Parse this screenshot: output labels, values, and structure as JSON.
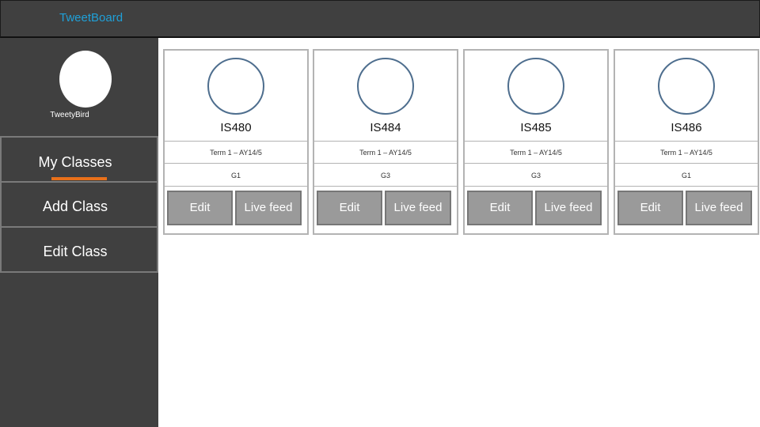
{
  "header": {
    "title": "TweetBoard",
    "title_color": "#1fa0d8"
  },
  "sidebar": {
    "username": "TweetyBird",
    "active_color": "#e8701a",
    "items": [
      {
        "label": "My Classes",
        "active": true
      },
      {
        "label": "Add Class",
        "active": false
      },
      {
        "label": "Edit Class",
        "active": false
      }
    ]
  },
  "classes": [
    {
      "code": "IS480",
      "term": "Term 1 – AY14/5",
      "group": "G1",
      "edit_label": "Edit",
      "live_label": "Live feed"
    },
    {
      "code": "IS484",
      "term": "Term 1 – AY14/5",
      "group": "G3",
      "edit_label": "Edit",
      "live_label": "Live feed"
    },
    {
      "code": "IS485",
      "term": "Term 1 – AY14/5",
      "group": "G3",
      "edit_label": "Edit",
      "live_label": "Live feed"
    },
    {
      "code": "IS486",
      "term": "Term 1 – AY14/5",
      "group": "G1",
      "edit_label": "Edit",
      "live_label": "Live feed"
    }
  ]
}
